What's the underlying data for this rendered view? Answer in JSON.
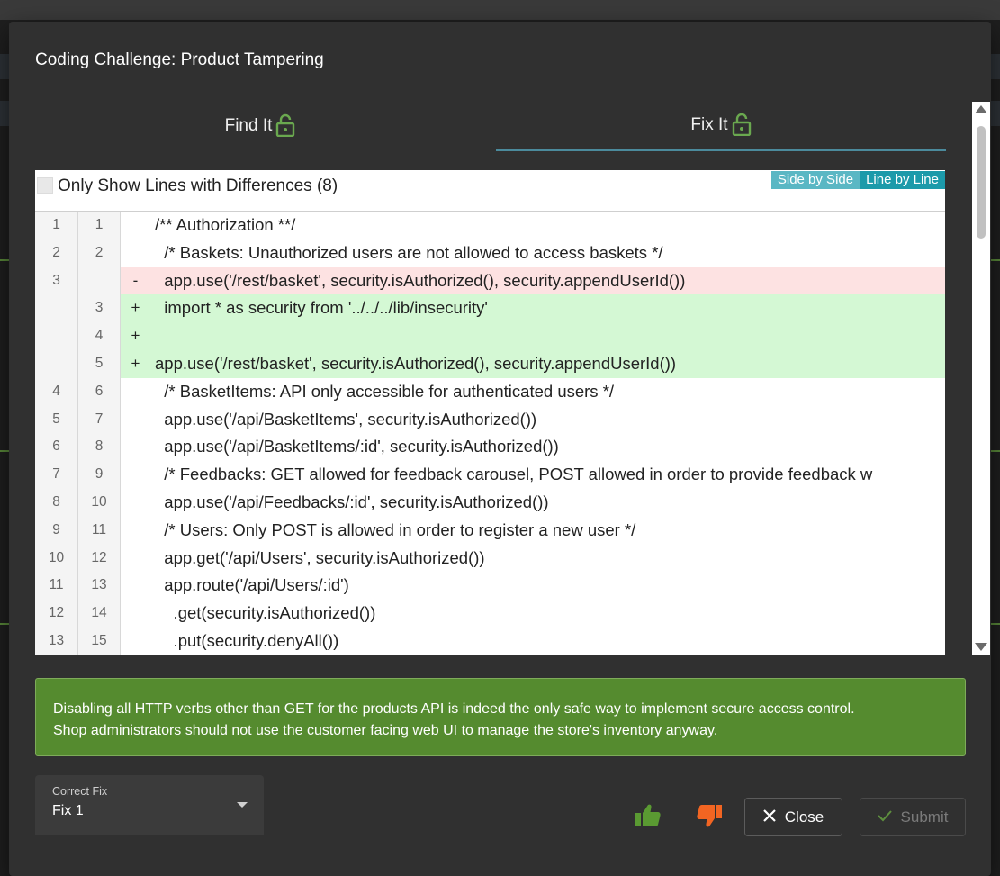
{
  "dialog": {
    "title": "Coding Challenge: Product Tampering"
  },
  "tabs": [
    {
      "label": "Find It",
      "icon": "lock-open-icon",
      "active": false
    },
    {
      "label": "Fix It",
      "icon": "lock-open-icon",
      "active": true
    }
  ],
  "filter": {
    "label": "Only Show Lines with Differences (8)",
    "checked": false
  },
  "view_toggle": {
    "side_by_side": "Side by Side",
    "line_by_line": "Line by Line",
    "selected": "Line by Line"
  },
  "diff_lines": [
    {
      "old": "1",
      "new": "1",
      "sign": "",
      "type": "ctx",
      "text": "/** Authorization **/"
    },
    {
      "old": "2",
      "new": "2",
      "sign": "",
      "type": "ctx",
      "text": "  /* Baskets: Unauthorized users are not allowed to access baskets */"
    },
    {
      "old": "3",
      "new": "",
      "sign": "-",
      "type": "del",
      "text": "  app.use('/rest/basket', security.isAuthorized(), security.appendUserId())"
    },
    {
      "old": "",
      "new": "3",
      "sign": "+",
      "type": "add",
      "text": "  import * as security from '../../../lib/insecurity'"
    },
    {
      "old": "",
      "new": "4",
      "sign": "+",
      "type": "add",
      "text": ""
    },
    {
      "old": "",
      "new": "5",
      "sign": "+",
      "type": "add",
      "text": "app.use('/rest/basket', security.isAuthorized(), security.appendUserId())"
    },
    {
      "old": "4",
      "new": "6",
      "sign": "",
      "type": "ctx",
      "text": "  /* BasketItems: API only accessible for authenticated users */"
    },
    {
      "old": "5",
      "new": "7",
      "sign": "",
      "type": "ctx",
      "text": "  app.use('/api/BasketItems', security.isAuthorized())"
    },
    {
      "old": "6",
      "new": "8",
      "sign": "",
      "type": "ctx",
      "text": "  app.use('/api/BasketItems/:id', security.isAuthorized())"
    },
    {
      "old": "7",
      "new": "9",
      "sign": "",
      "type": "ctx",
      "text": "  /* Feedbacks: GET allowed for feedback carousel, POST allowed in order to provide feedback w"
    },
    {
      "old": "8",
      "new": "10",
      "sign": "",
      "type": "ctx",
      "text": "  app.use('/api/Feedbacks/:id', security.isAuthorized())"
    },
    {
      "old": "9",
      "new": "11",
      "sign": "",
      "type": "ctx",
      "text": "  /* Users: Only POST is allowed in order to register a new user */"
    },
    {
      "old": "10",
      "new": "12",
      "sign": "",
      "type": "ctx",
      "text": "  app.get('/api/Users', security.isAuthorized())"
    },
    {
      "old": "11",
      "new": "13",
      "sign": "",
      "type": "ctx",
      "text": "  app.route('/api/Users/:id')"
    },
    {
      "old": "12",
      "new": "14",
      "sign": "",
      "type": "ctx",
      "text": "    .get(security.isAuthorized())"
    },
    {
      "old": "13",
      "new": "15",
      "sign": "",
      "type": "ctx",
      "text": "    .put(security.denyAll())"
    }
  ],
  "feedback": {
    "line1": "Disabling all HTTP verbs other than GET for the products API is indeed the only safe way to implement secure access control.",
    "line2": "Shop administrators should not use the customer facing web UI to manage the store's inventory anyway."
  },
  "correct_fix": {
    "label": "Correct Fix",
    "value": "Fix 1"
  },
  "actions": {
    "close_label": "Close",
    "submit_label": "Submit"
  },
  "colors": {
    "accent_green": "#558b2f",
    "lock_green": "#6aa84f",
    "thumb_up": "#5a9a32",
    "thumb_down": "#f26522",
    "tab_underline": "#4b8a9c"
  }
}
